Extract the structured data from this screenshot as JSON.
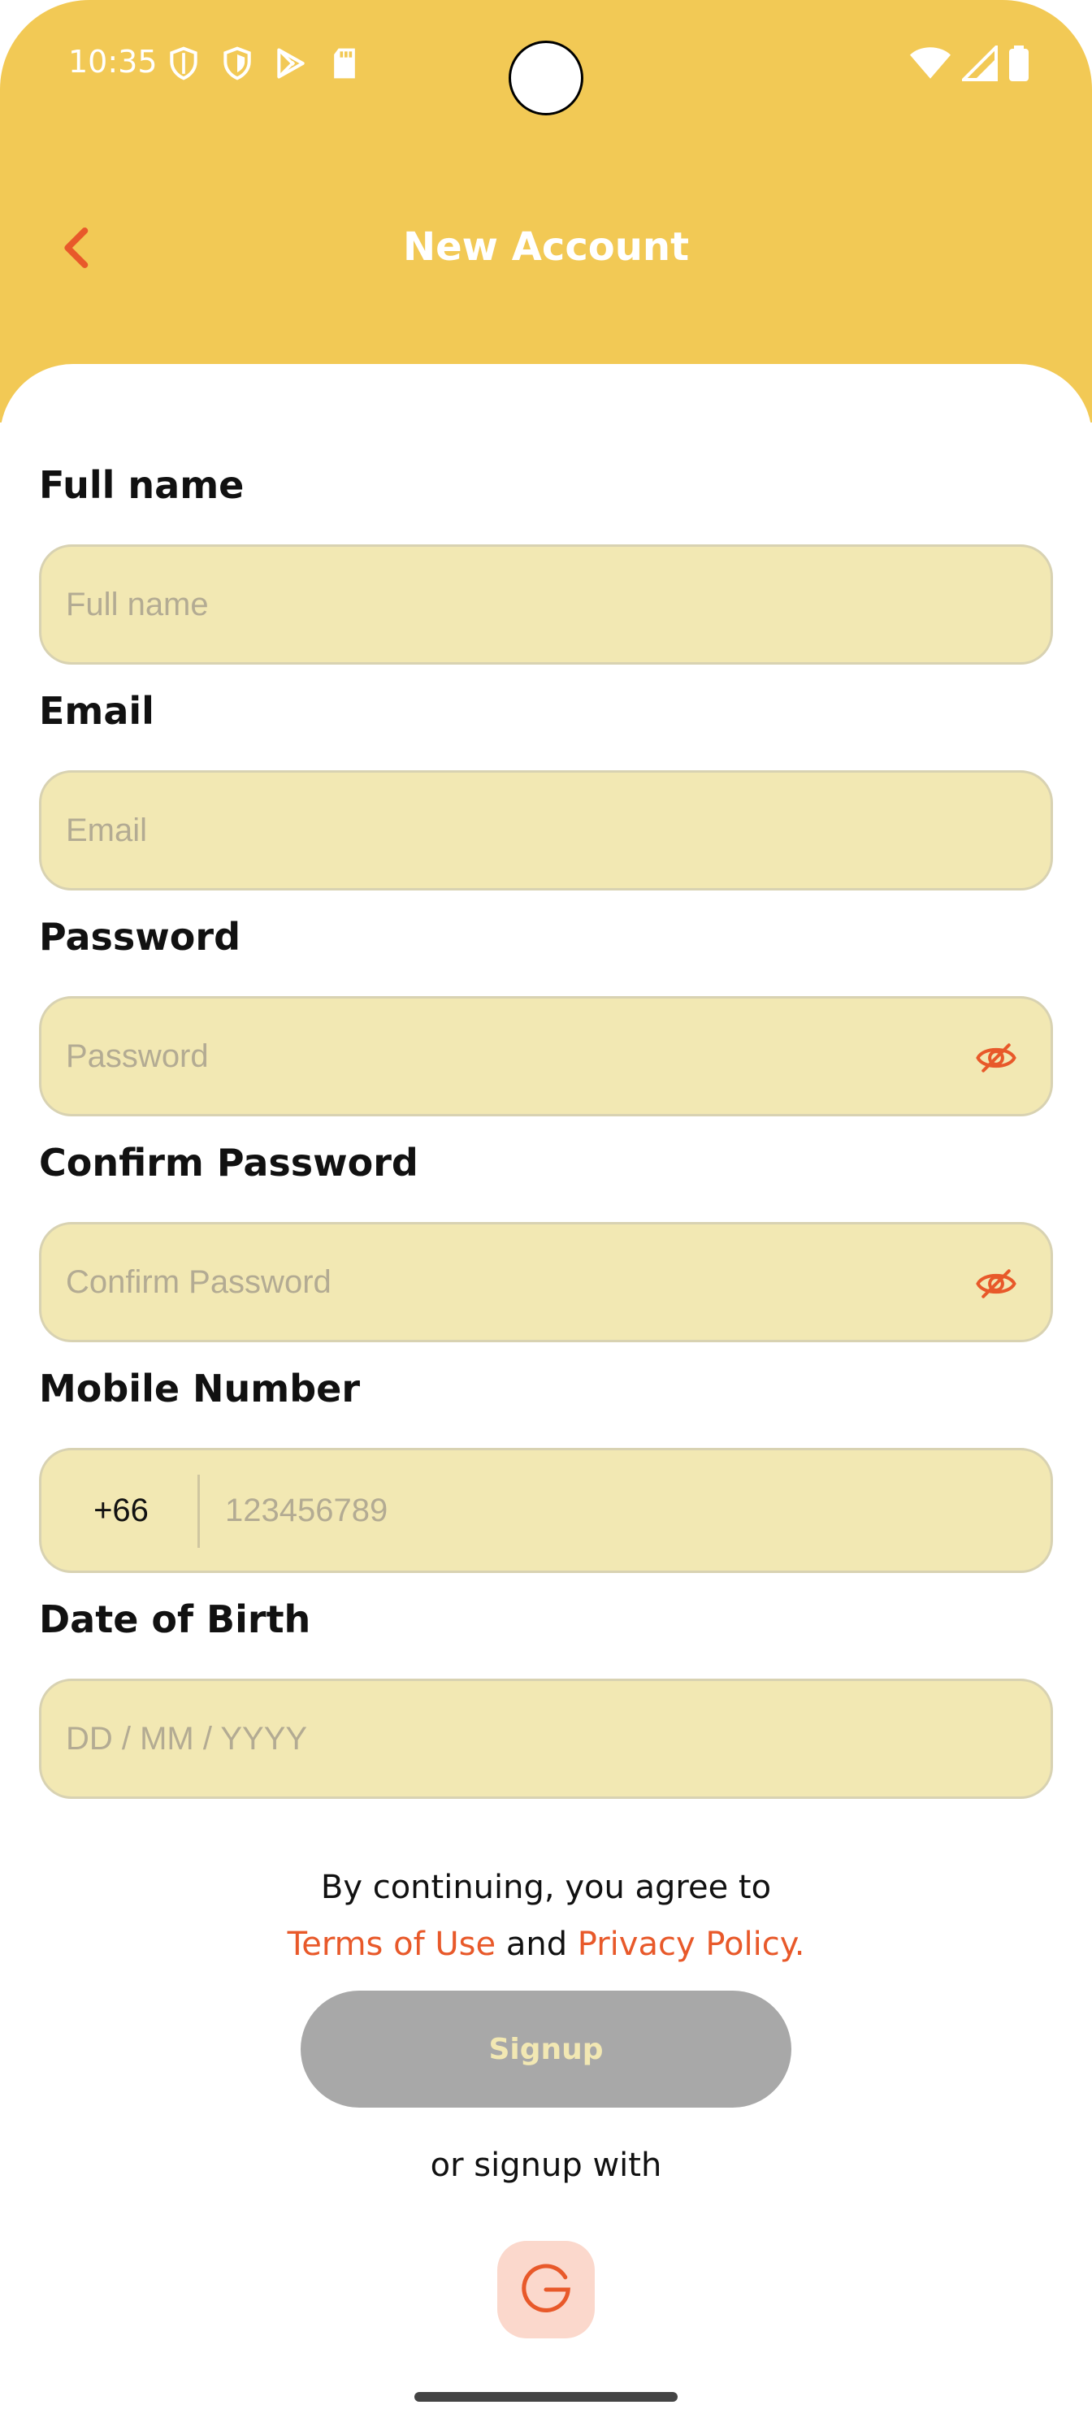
{
  "status": {
    "time": "10:35",
    "left_icons": [
      "shield-icon",
      "shield-icon",
      "play-store-icon",
      "sd-card-icon"
    ],
    "right_icons": [
      "wifi-icon",
      "signal-icon",
      "battery-icon"
    ]
  },
  "header": {
    "title": "New Account",
    "back_icon": "chevron-left-icon"
  },
  "form": {
    "full_name": {
      "label": "Full name",
      "placeholder": "Full name"
    },
    "email": {
      "label": "Email",
      "placeholder": "Email"
    },
    "password": {
      "label": "Password",
      "placeholder": "Password",
      "toggle_icon": "eye-off-icon"
    },
    "confirm_password": {
      "label": "Confirm Password",
      "placeholder": "Confirm Password",
      "toggle_icon": "eye-off-icon"
    },
    "mobile": {
      "label": "Mobile Number",
      "country_code": "+66",
      "placeholder": "123456789"
    },
    "dob": {
      "label": "Date of Birth",
      "placeholder": "DD / MM / YYYY"
    }
  },
  "terms": {
    "line1": "By continuing, you agree to",
    "terms_link": "Terms of Use",
    "and": " and ",
    "privacy_link": "Privacy Policy."
  },
  "actions": {
    "signup_label": "Signup",
    "or_text": "or signup with",
    "google_icon": "google-icon"
  },
  "colors": {
    "header": "#F2C955",
    "field_bg": "#F2E8B3",
    "accent": "#E8592A",
    "button_disabled": "#A8A8A8",
    "google_bg": "#FBD8CC"
  }
}
